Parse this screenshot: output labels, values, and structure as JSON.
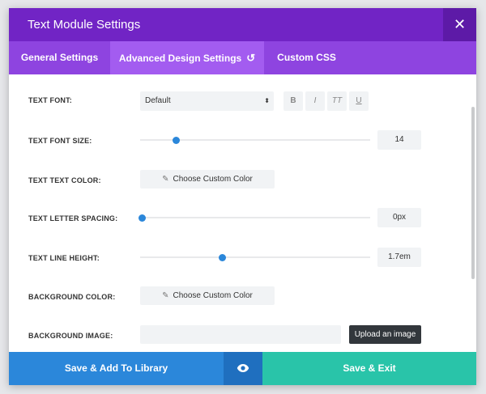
{
  "header": {
    "title": "Text Module Settings",
    "close_glyph": "✕"
  },
  "tabs": [
    {
      "label": "General Settings"
    },
    {
      "label": "Advanced Design Settings",
      "reset_glyph": "↺"
    },
    {
      "label": "Custom CSS"
    }
  ],
  "rows": {
    "text_font": {
      "label": "TEXT FONT:",
      "select_value": "Default",
      "select_arrow": "⬍",
      "format_buttons": {
        "bold": "B",
        "italic": "I",
        "uppercase": "TT",
        "underline": "U"
      }
    },
    "text_font_size": {
      "label": "TEXT FONT SIZE:",
      "value": "14",
      "slider_fraction": 0.15
    },
    "text_color": {
      "label": "TEXT TEXT COLOR:",
      "button": "Choose Custom Color",
      "pen_glyph": "✎"
    },
    "letter_spacing": {
      "label": "TEXT LETTER SPACING:",
      "value": "0px",
      "slider_fraction": 0.0
    },
    "line_height": {
      "label": "TEXT LINE HEIGHT:",
      "value": "1.7em",
      "slider_fraction": 0.35
    },
    "background_color": {
      "label": "BACKGROUND COLOR:",
      "button": "Choose Custom Color",
      "pen_glyph": "✎"
    },
    "background_image": {
      "label": "BACKGROUND IMAGE:",
      "input_value": "",
      "upload_button": "Upload an image"
    }
  },
  "footer": {
    "save_library": "Save & Add To Library",
    "preview_icon": "eye-icon",
    "save_exit": "Save & Exit"
  },
  "colors": {
    "header": "#7124c5",
    "tabs": "#8e44e0",
    "library": "#2b87da",
    "exit": "#29c4a9",
    "slider_knob": "#2b87da"
  }
}
